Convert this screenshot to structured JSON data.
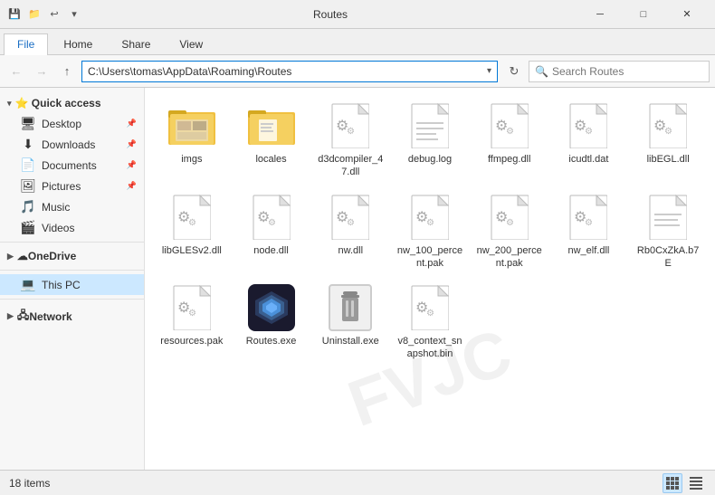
{
  "titleBar": {
    "icons": [
      "save-icon",
      "folder-icon",
      "undo-icon"
    ],
    "title": "Routes",
    "controls": [
      "minimize",
      "maximize",
      "close"
    ]
  },
  "ribbon": {
    "tabs": [
      "File",
      "Home",
      "Share",
      "View"
    ],
    "activeTab": "Home"
  },
  "addressBar": {
    "path": "C:\\Users\\tomas\\AppData\\Roaming\\Routes",
    "searchPlaceholder": "Search Routes"
  },
  "sidebar": {
    "sections": [
      {
        "label": "Quick access",
        "items": [
          {
            "label": "Desktop",
            "icon": "desktop",
            "pinned": true
          },
          {
            "label": "Downloads",
            "icon": "downloads",
            "pinned": true
          },
          {
            "label": "Documents",
            "icon": "documents",
            "pinned": true
          },
          {
            "label": "Pictures",
            "icon": "pictures",
            "pinned": true
          },
          {
            "label": "Music",
            "icon": "music",
            "pinned": false
          },
          {
            "label": "Videos",
            "icon": "videos",
            "pinned": false
          }
        ]
      },
      {
        "label": "OneDrive",
        "items": []
      },
      {
        "label": "This PC",
        "items": [],
        "active": true
      },
      {
        "label": "Network",
        "items": []
      }
    ]
  },
  "files": [
    {
      "name": "imgs",
      "type": "folder"
    },
    {
      "name": "locales",
      "type": "folder"
    },
    {
      "name": "d3dcompiler_47.dll",
      "type": "dll"
    },
    {
      "name": "debug.log",
      "type": "log"
    },
    {
      "name": "ffmpeg.dll",
      "type": "dll"
    },
    {
      "name": "icudtl.dat",
      "type": "dat"
    },
    {
      "name": "libEGL.dll",
      "type": "dll"
    },
    {
      "name": "libGLESv2.dll",
      "type": "dll"
    },
    {
      "name": "node.dll",
      "type": "dll"
    },
    {
      "name": "nw.dll",
      "type": "dll"
    },
    {
      "name": "nw_100_percent.pak",
      "type": "pak"
    },
    {
      "name": "nw_200_percent.pak",
      "type": "pak"
    },
    {
      "name": "nw_elf.dll",
      "type": "dll"
    },
    {
      "name": "Rb0CxZkA.b7E",
      "type": "generic"
    },
    {
      "name": "resources.pak",
      "type": "pak"
    },
    {
      "name": "Routes.exe",
      "type": "exe"
    },
    {
      "name": "Uninstall.exe",
      "type": "uninstall"
    },
    {
      "name": "v8_context_snapshot.bin",
      "type": "dat"
    }
  ],
  "statusBar": {
    "count": "18 items"
  }
}
